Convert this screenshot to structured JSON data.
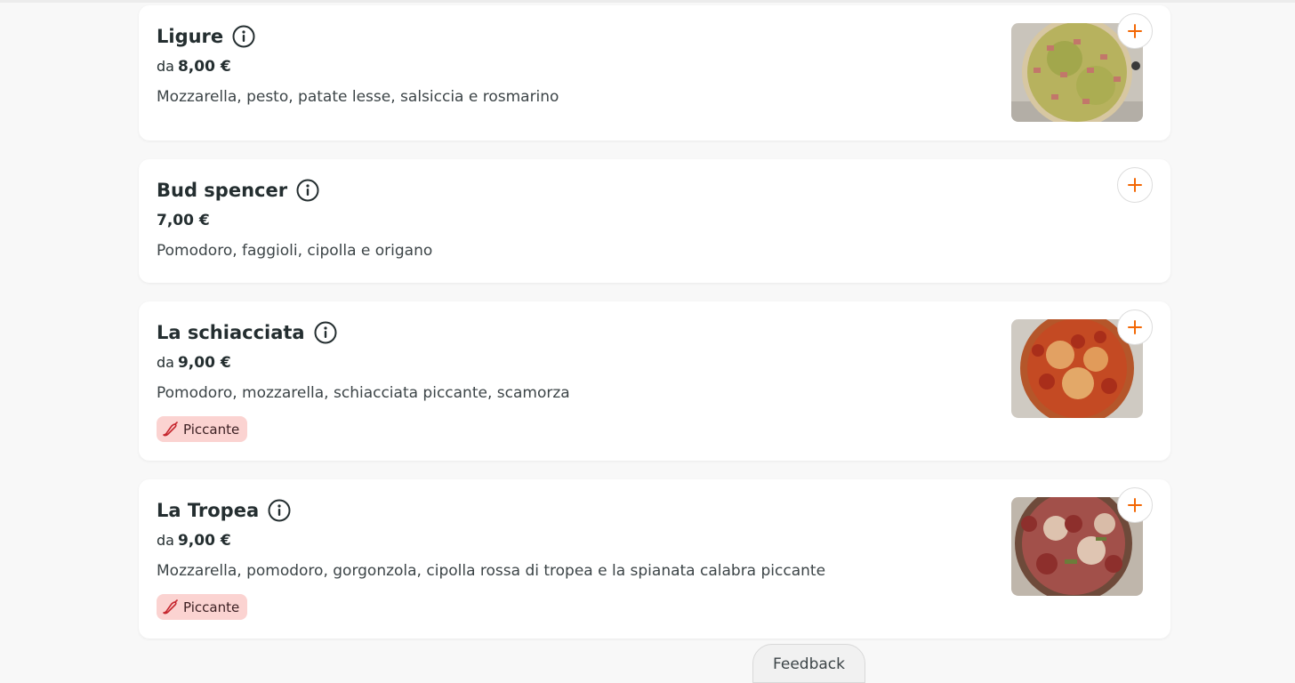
{
  "colors": {
    "accent": "#f36805",
    "badge_bg": "#fbd3d1",
    "badge_icon": "#c6262e",
    "text": "#242e30"
  },
  "items": [
    {
      "name": "Ligure",
      "price_prefix": "da",
      "price": "8,00 €",
      "description": "Mozzarella, pesto, patate lesse, salsiccia e rosmarino",
      "has_image": true
    },
    {
      "name": "Bud spencer",
      "price_prefix": "",
      "price": "7,00 €",
      "description": "Pomodoro, faggioli, cipolla e origano",
      "has_image": false
    },
    {
      "name": "La schiacciata",
      "price_prefix": "da",
      "price": "9,00 €",
      "description": "Pomodoro, mozzarella, schiacciata piccante, scamorza",
      "badge": "Piccante",
      "has_image": true
    },
    {
      "name": "La Tropea",
      "price_prefix": "da",
      "price": "9,00 €",
      "description": "Mozzarella, pomodoro, gorgonzola, cipolla rossa di tropea e la spianata calabra piccante",
      "badge": "Piccante",
      "has_image": true
    }
  ],
  "icons": {
    "info": "info-icon",
    "add": "plus-icon",
    "badge": "chili-pepper-icon"
  },
  "feedback_label": "Feedback"
}
